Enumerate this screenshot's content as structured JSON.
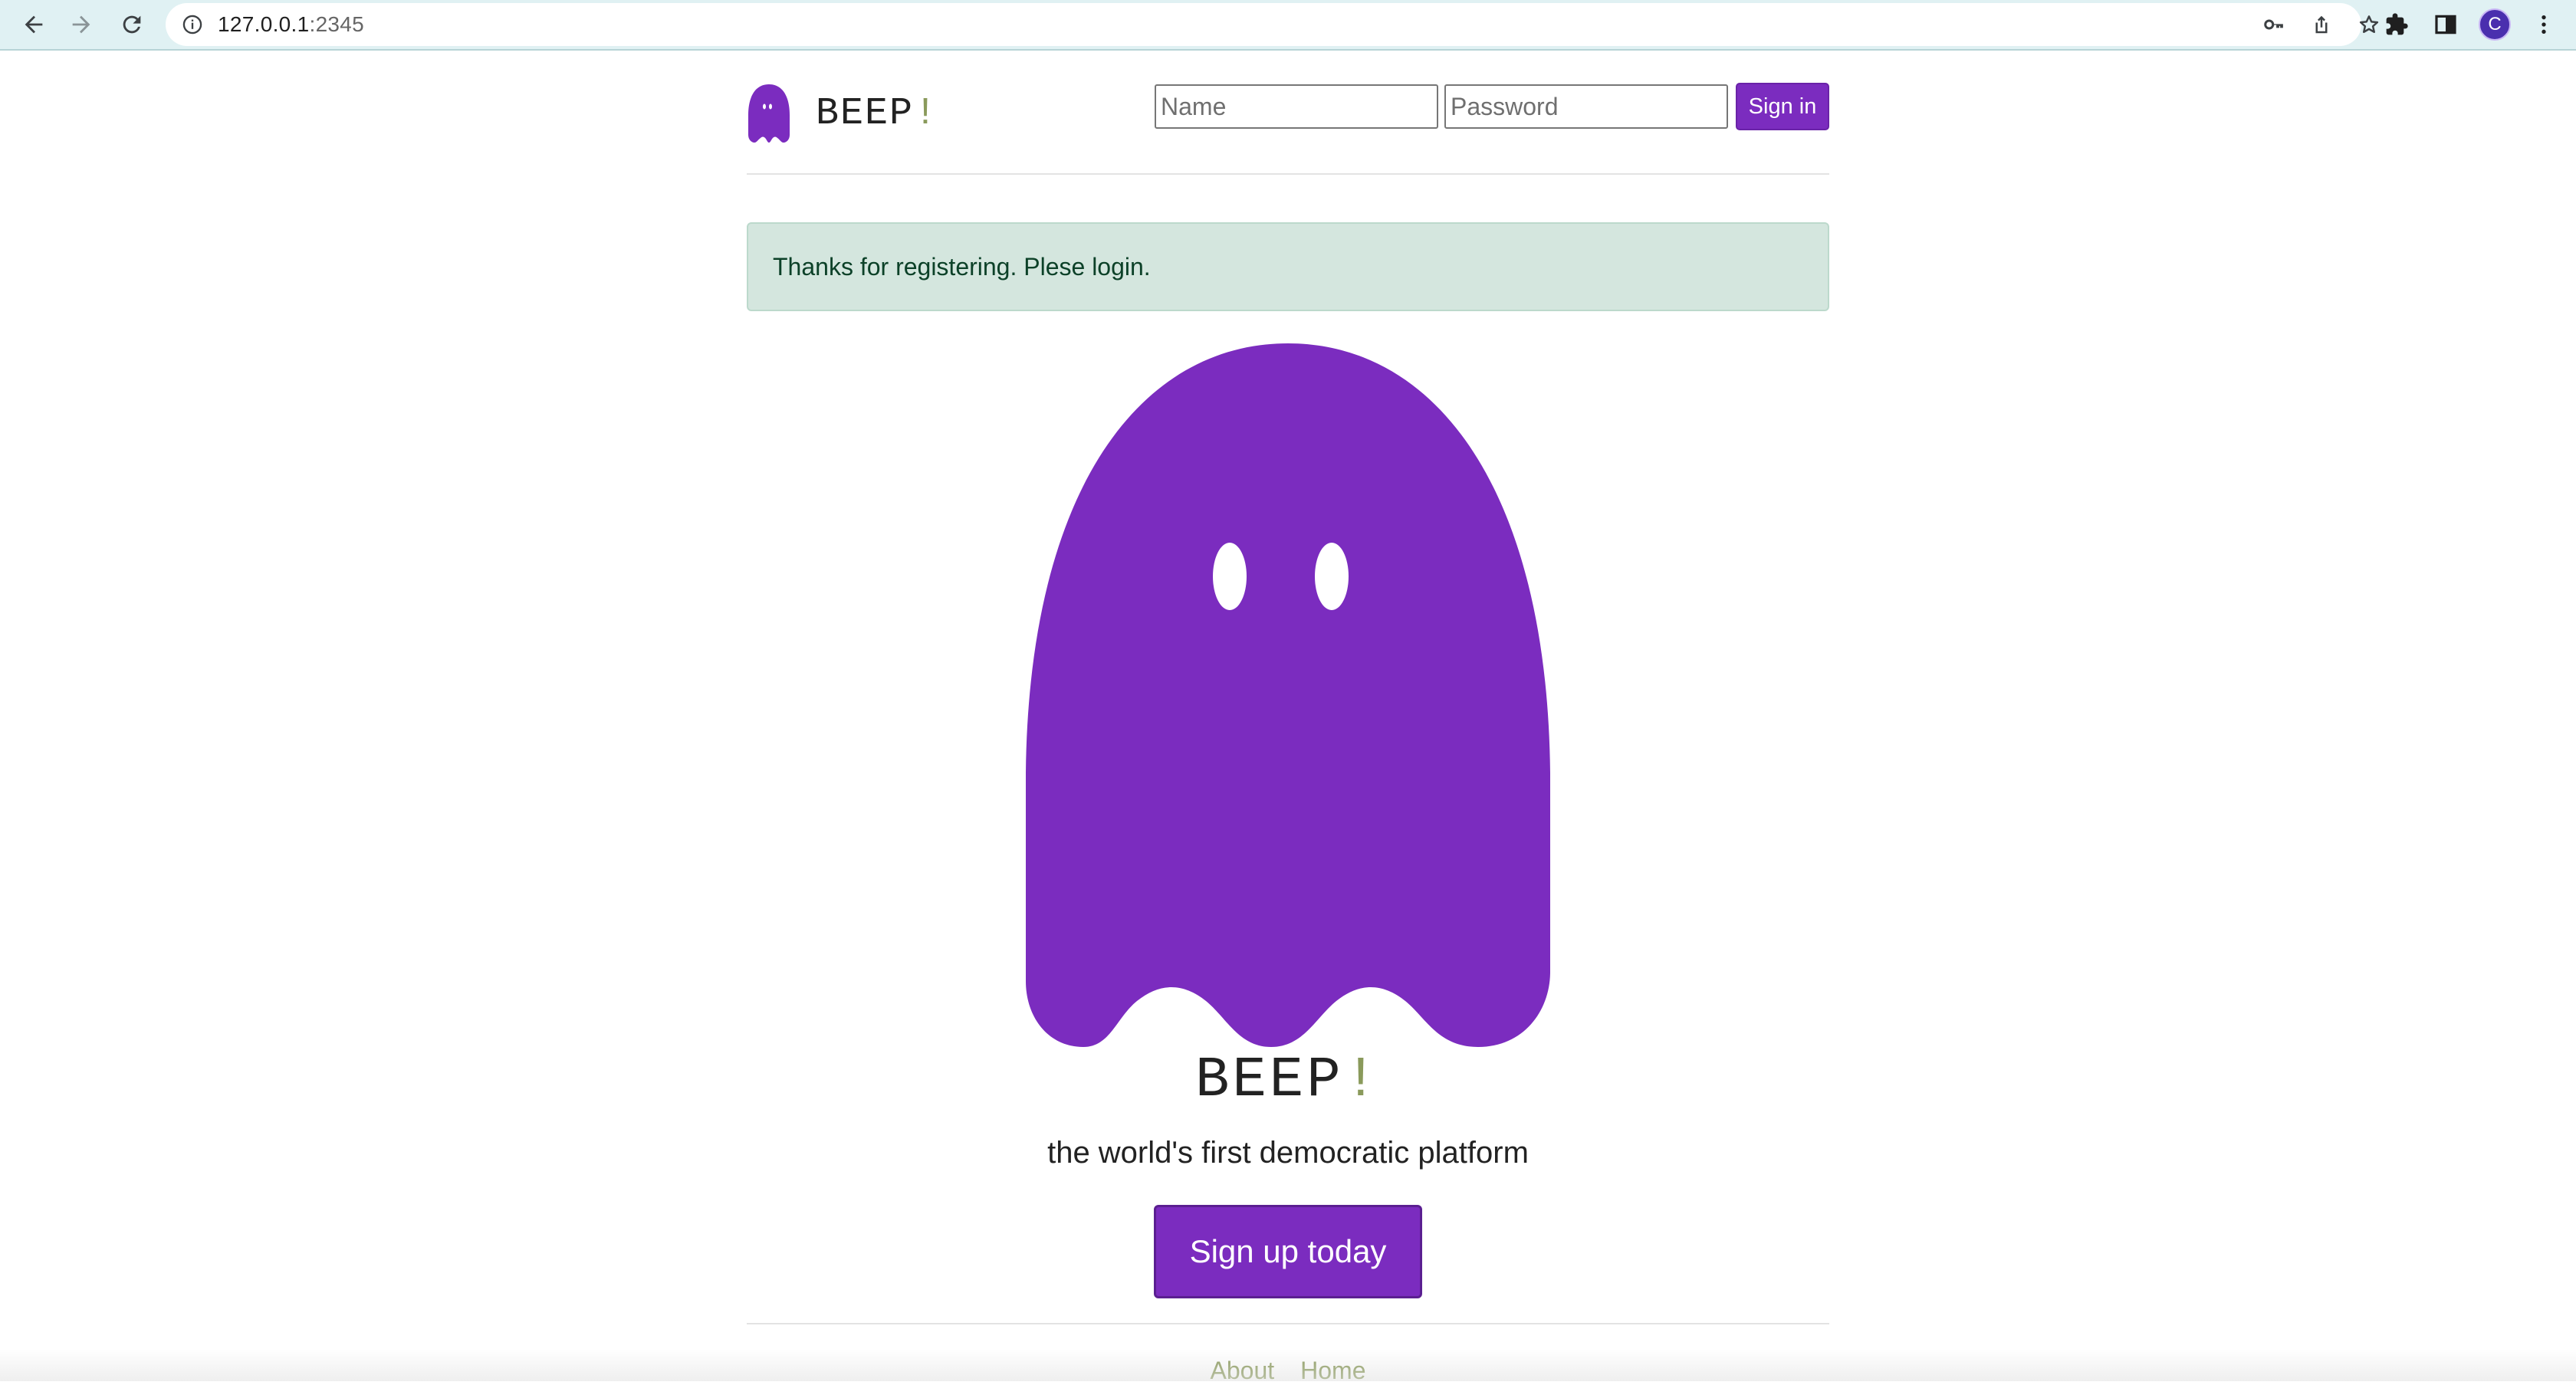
{
  "browser": {
    "url_host": "127.0.0.1",
    "url_port": ":2345",
    "profile_initial": "C",
    "theme_color": "#e0f1f3"
  },
  "header": {
    "brand_name": "BEEP",
    "brand_bang": "!",
    "name_placeholder": "Name",
    "password_placeholder": "Password",
    "signin_label": "Sign in"
  },
  "alert": {
    "message": "Thanks for registering. Plese login."
  },
  "hero": {
    "title": "BEEP",
    "title_bang": "!",
    "tagline": "the world's first democratic platform",
    "cta_label": "Sign up today"
  },
  "footer": {
    "links": [
      {
        "label": "About"
      },
      {
        "label": "Home"
      }
    ]
  },
  "colors": {
    "accent": "#7b2cbf",
    "bang": "#8a9a5b",
    "alert_bg": "#d4e6de",
    "alert_text": "#0c4128"
  },
  "icons": [
    "back-arrow-icon",
    "forward-arrow-icon",
    "reload-icon",
    "info-icon",
    "key-icon",
    "share-icon",
    "star-icon",
    "extensions-icon",
    "side-panel-icon",
    "menu-dots-icon",
    "ghost-logo-icon"
  ]
}
